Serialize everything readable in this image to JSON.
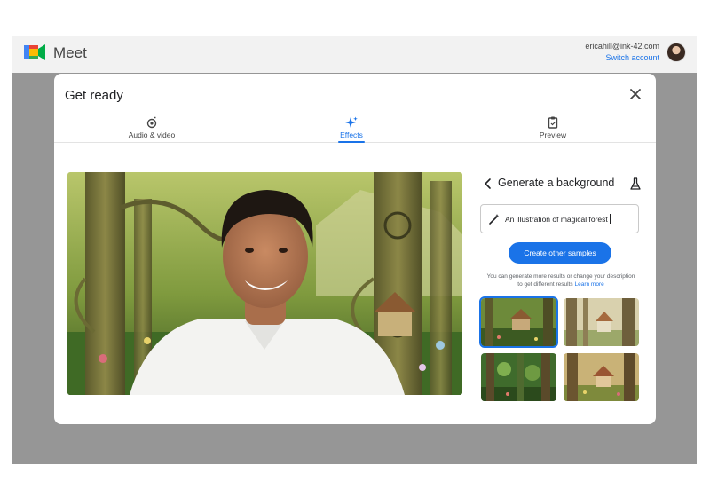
{
  "app": {
    "name": "Meet"
  },
  "account": {
    "email": "ericahill@ink-42.com",
    "switch_label": "Switch account"
  },
  "dialog": {
    "title": "Get ready",
    "tabs": [
      {
        "label": "Audio & video",
        "icon": "camera-settings-icon"
      },
      {
        "label": "Effects",
        "icon": "sparkle-icon"
      },
      {
        "label": "Preview",
        "icon": "clipboard-icon"
      }
    ],
    "active_tab": "Effects"
  },
  "generator": {
    "title": "Generate a background",
    "prompt_value": "An illustration of magical forest",
    "create_label": "Create other samples",
    "hint_text": "You can generate more results or change your description to get different results",
    "learn_more": "Learn more",
    "samples_count": 4,
    "selected_sample": 1
  },
  "colors": {
    "accent": "#1a73e8",
    "backdrop": "#969696"
  }
}
